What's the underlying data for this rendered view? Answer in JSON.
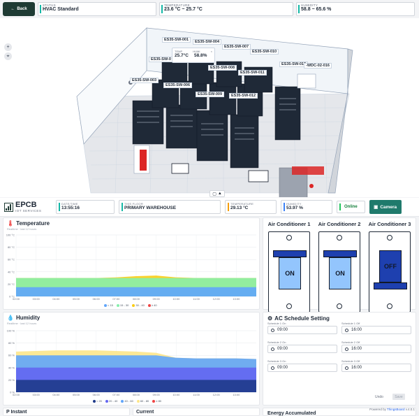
{
  "topbar": {
    "back_label": "Back",
    "status": {
      "label": "STATUS",
      "value": "HVAC Standard"
    },
    "temperature": {
      "label": "TEMPERATURE",
      "value": "23.6 °C ~ 25.7 °C"
    },
    "humidity": {
      "label": "HUMIDITY",
      "value": "58.8 ~ 65.6 %"
    }
  },
  "scene": {
    "server_labels": [
      "ES35-SW-001",
      "ES35-SW-004",
      "ES35-SW-007",
      "ES35-SW-010",
      "ES35-SW-0",
      "ES35-SW-008",
      "ES35-SW-013",
      "ES35-SW-011",
      "ES35-SW-003",
      "ES35-SW-006",
      "ES35-SW-009",
      "ES35-SW-012",
      "-WDC-02-016"
    ],
    "tooltip": {
      "temp_label": "TEMP",
      "temp_value": "25.7°C",
      "humi_label": "HUMI",
      "humi_value": "58.8%",
      "close": "×"
    },
    "zoom_in": "+",
    "locate": "⌖",
    "collapse": "▲"
  },
  "header": {
    "logo_name": "EPCB",
    "logo_sub": "IOT SERVICES",
    "datetime": {
      "label": "DATE/TIME",
      "value": "13:55:16"
    },
    "floor": {
      "label": "THIS FLOOR",
      "value": "PRIMARY WAREHOUSE"
    },
    "temperature": {
      "label": "TEMPERATURE",
      "value": "29.13 °C"
    },
    "humidity": {
      "label": "HUMIDITY",
      "value": "53.97 %"
    },
    "online": "Online",
    "camera": "Camera"
  },
  "temperature_panel": {
    "title": "Temperature",
    "subtitle": "Realtime · last 12 hours",
    "legend": [
      {
        "label": "< 15",
        "color": "#60a5fa"
      },
      {
        "label": "15 - 30",
        "color": "#86efac"
      },
      {
        "label": "30 - 40",
        "color": "#facc15"
      },
      {
        "label": "≥ 40",
        "color": "#ef4444"
      }
    ]
  },
  "humidity_panel": {
    "title": "Humidity",
    "subtitle": "Realtime · last 12 hours",
    "legend": [
      {
        "label": "< 20",
        "color": "#1e3a8a"
      },
      {
        "label": "20 - 40",
        "color": "#6366f1"
      },
      {
        "label": "40 - 60",
        "color": "#60a5fa"
      },
      {
        "label": "60 - 80",
        "color": "#fde68a"
      },
      {
        "label": "≥ 80",
        "color": "#ef4444"
      }
    ]
  },
  "chart_data": [
    {
      "type": "area",
      "title": "Temperature",
      "x": [
        "02:00",
        "03:00",
        "04:00",
        "05:00",
        "06:00",
        "07:00",
        "08:00",
        "09:00",
        "10:00",
        "11:00",
        "12:00",
        "13:00"
      ],
      "ylim": [
        0,
        100
      ],
      "yticks": [
        "0 °C",
        "20 °C",
        "40 °C",
        "60 °C",
        "80 °C",
        "100 °C"
      ],
      "series": [
        {
          "name": "< 15",
          "values": [
            15,
            15,
            15,
            15,
            15,
            15,
            15,
            15,
            15,
            15,
            15,
            15,
            15
          ]
        },
        {
          "name": "15 - 30",
          "values": [
            30,
            30,
            30,
            30,
            30,
            30,
            30,
            30,
            30,
            30,
            30,
            30,
            30
          ]
        },
        {
          "name": "30 - 40",
          "values": [
            30,
            30,
            30,
            30,
            30,
            31,
            33,
            34,
            31,
            30,
            30,
            30,
            30
          ]
        }
      ]
    },
    {
      "type": "area",
      "title": "Humidity",
      "x": [
        "02:00",
        "03:00",
        "04:00",
        "05:00",
        "06:00",
        "07:00",
        "08:00",
        "09:00",
        "10:00",
        "11:00",
        "12:00",
        "13:00"
      ],
      "ylim": [
        0,
        100
      ],
      "yticks": [
        "0 %",
        "20 %",
        "40 %",
        "60 %",
        "80 %",
        "100 %"
      ],
      "series": [
        {
          "name": "< 20",
          "values": [
            20,
            20,
            20,
            20,
            20,
            20,
            20,
            20,
            20,
            20,
            20,
            20,
            20
          ]
        },
        {
          "name": "20 - 40",
          "values": [
            40,
            40,
            40,
            40,
            40,
            40,
            40,
            40,
            40,
            40,
            40,
            40,
            40
          ]
        },
        {
          "name": "40 - 60",
          "values": [
            60,
            60,
            60,
            60,
            60,
            60,
            60,
            60,
            56,
            55,
            55,
            55,
            54
          ]
        },
        {
          "name": "60 - 80",
          "values": [
            66,
            67,
            68,
            68,
            68,
            67,
            66,
            64,
            56,
            55,
            55,
            55,
            54
          ]
        }
      ]
    }
  ],
  "ac": [
    {
      "title": "Air Conditioner 1",
      "state": "ON",
      "color": "#93c5fd"
    },
    {
      "title": "Air Conditioner 2",
      "state": "ON",
      "color": "#93c5fd"
    },
    {
      "title": "Air Conditioner 3",
      "state": "OFF",
      "color": "#1e40af"
    }
  ],
  "schedule": {
    "title": "AC Schedule Setting",
    "items": [
      {
        "label": "Schedule 1 On",
        "value": "09:00"
      },
      {
        "label": "Schedule 1 Off",
        "value": "16:00"
      },
      {
        "label": "Schedule 2 On",
        "value": "09:00"
      },
      {
        "label": "Schedule 2 Off",
        "value": "16:00"
      },
      {
        "label": "Schedule 3 On",
        "value": "09:00"
      },
      {
        "label": "Schedule 3 Off",
        "value": "16:00"
      }
    ],
    "undo": "Undo",
    "save": "Save"
  },
  "bottom": {
    "instant": "P Instant",
    "current": "Current",
    "energy": "Energy Accumulated"
  },
  "footer": {
    "powered": "Powered by",
    "brand": "ThingsBoard",
    "version": "v.4.0.1"
  }
}
